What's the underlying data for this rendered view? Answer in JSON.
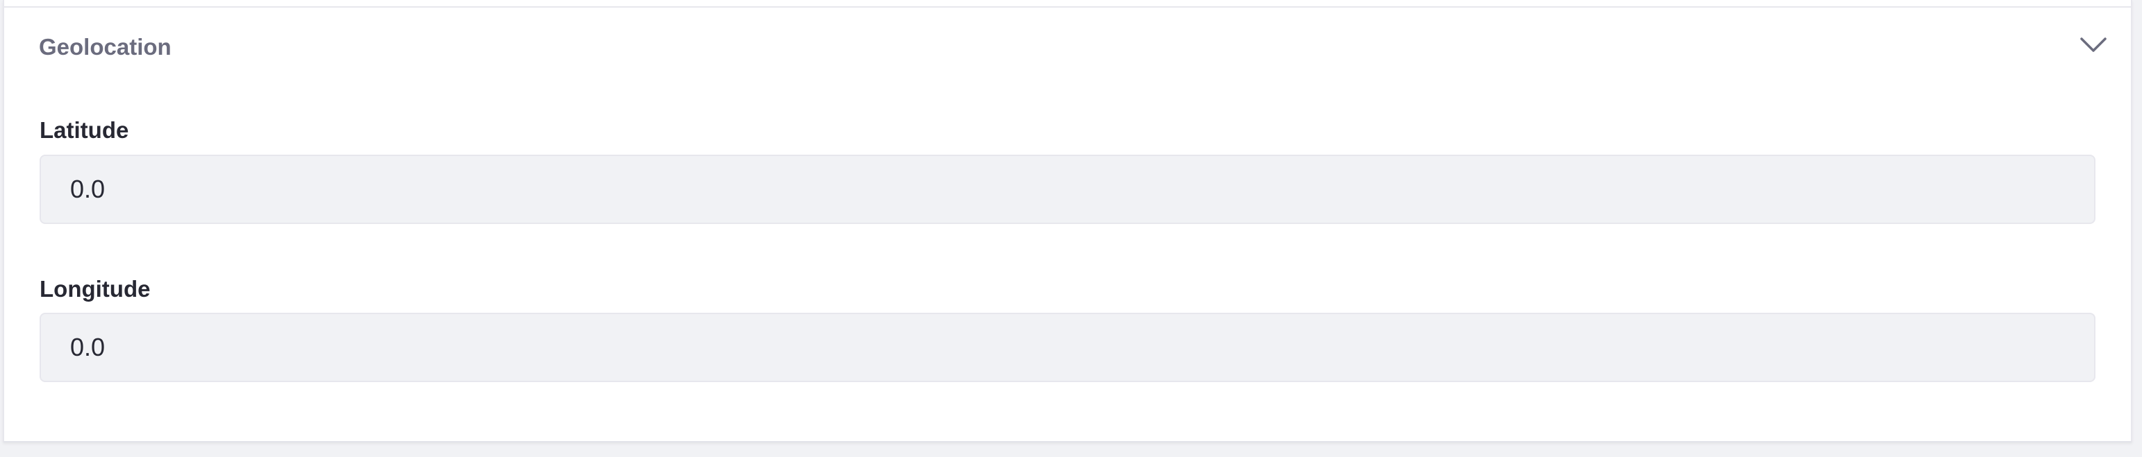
{
  "panel": {
    "title": "Geolocation",
    "toggle_icon": "chevron-down-icon",
    "expanded": true
  },
  "fields": {
    "latitude": {
      "label": "Latitude",
      "value": "0.0"
    },
    "longitude": {
      "label": "Longitude",
      "value": "0.0"
    }
  },
  "colors": {
    "page_background": "#f1f2f5",
    "panel_background": "#ffffff",
    "panel_border": "#e7e7ed",
    "title_text": "#6b6c7e",
    "label_text": "#272833",
    "input_background": "#f1f2f5"
  }
}
